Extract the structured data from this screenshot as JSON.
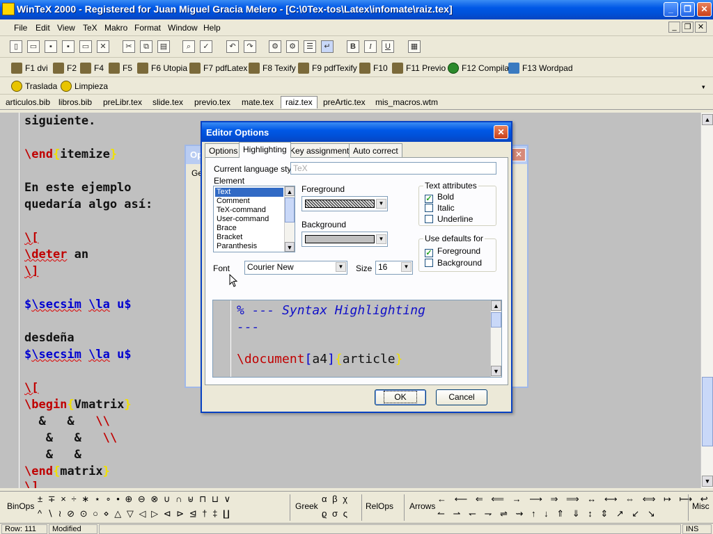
{
  "window": {
    "title": "WinTeX 2000 - Registered for Juan Miguel Gracia Melero - [C:\\0Tex-tos\\Latex\\infomate\\raiz.tex]"
  },
  "menu": [
    "File",
    "Edit",
    "View",
    "TeX",
    "Makro",
    "Format",
    "Window",
    "Help"
  ],
  "toolbar_main": {
    "bold": "B",
    "italic": "I",
    "underline": "U"
  },
  "toolbar_compile": [
    {
      "label": "F1 dvi"
    },
    {
      "label": "F2"
    },
    {
      "label": "F4"
    },
    {
      "label": "F5"
    },
    {
      "label": "F6 Utopia"
    },
    {
      "label": "F7 pdfLatex"
    },
    {
      "label": "F8 Texify"
    },
    {
      "label": "F9 pdfTexify"
    },
    {
      "label": "F10"
    },
    {
      "label": "F11 Previo"
    },
    {
      "label": "F12 Compila"
    },
    {
      "label": "F13 Wordpad"
    }
  ],
  "toolbar_macros": [
    {
      "label": "Traslada"
    },
    {
      "label": "Limpieza"
    }
  ],
  "file_tabs": [
    "articulos.bib",
    "libros.bib",
    "preLibr.tex",
    "slide.tex",
    "previo.tex",
    "mate.tex",
    "raiz.tex",
    "preArtic.tex",
    "mis_macros.wtm"
  ],
  "active_tab": "raiz.tex",
  "editor": {
    "l1": "siguiente.",
    "l2_cmd": "\\end",
    "l2_lb": "{",
    "l2_arg": "itemize",
    "l2_rb": "}",
    "l3a": "En este ejemplo",
    "l3b": "quedaría algo así:",
    "l4": "\\[",
    "l5_cmd": "\\deter",
    "l5_rest": " an",
    "l6": "\\]",
    "l7_dollar": "$",
    "l7_cmd": "\\secsim",
    "l7_sp": " ",
    "l7_cmd2": "\\la",
    "l7_rest": " u",
    "l7_end": "$",
    "l8": "desdeña",
    "l9_dollar": "$",
    "l9_cmd": "\\secsim",
    "l9_sp": " ",
    "l9_cmd2": "\\la",
    "l9_rest": " u",
    "l9_end": "$",
    "l10": "\\[",
    "l11_cmd": "\\begin",
    "l11_lb": "{",
    "l11_arg": "Vmatrix",
    "l11_rb": "}",
    "l12_amp": "  &   &   ",
    "l12_bs": "\\\\",
    "l13_amp": "   &   &   ",
    "l13_bs": "\\\\",
    "l14_amp": "   &   &",
    "l15_cmd": "\\end",
    "l15_lb": "{",
    "l15_arg": "matrix",
    "l15_rb": "}",
    "l16": "\\]"
  },
  "background_dialog": {
    "title_fragment": "Op",
    "tab_fragment": "Ge"
  },
  "dialog": {
    "title": "Editor Options",
    "tabs": [
      "Options",
      "Highlighting",
      "Key assignments",
      "Auto correct"
    ],
    "active_tab": "Highlighting",
    "language_label": "Current language style",
    "language_value": "TeX",
    "element_label": "Element",
    "elements": [
      "Text",
      "Comment",
      "TeX-command",
      "User-command",
      "Brace",
      "Bracket",
      "Paranthesis"
    ],
    "selected_element": "Text",
    "foreground_label": "Foreground",
    "background_label": "Background",
    "text_attributes": {
      "title": "Text attributes",
      "bold": {
        "label": "Bold",
        "checked": true
      },
      "italic": {
        "label": "Italic",
        "checked": false
      },
      "underline": {
        "label": "Underline",
        "checked": false
      }
    },
    "use_defaults": {
      "title": "Use defaults for",
      "foreground": {
        "label": "Foreground",
        "checked": true
      },
      "background": {
        "label": "Background",
        "checked": false
      }
    },
    "font_label": "Font",
    "font_value": "Courier New",
    "size_label": "Size",
    "size_value": "16",
    "preview": {
      "line1": "% --- Syntax Highlighting",
      "line2": "---",
      "l3_cmd": "\\document",
      "l3_lbr": "[",
      "l3_opt": "a4",
      "l3_rbr": "]",
      "l3_lb": "{",
      "l3_arg": "article",
      "l3_rb": "}"
    },
    "ok": "OK",
    "cancel": "Cancel"
  },
  "palette": {
    "binops": "BinOps",
    "binops_row1": "± ∓ × ÷ ∗ ⋆ ∘ • ⊕ ⊖ ⊗ ∪ ∩ ⊎ ⊓ ⊔ ∨",
    "binops_row2": "^ ∖ ≀ ⊘ ⊙ ○ ⋄ △ ▽ ◁ ▷ ⊲ ⊳ ⊴ † ‡ ∐",
    "greek": "Greek",
    "greek_row1": "α β χ",
    "greek_row2": "ϱ σ ς",
    "relops": "RelOps",
    "arrows": "Arrows",
    "arrows_row1": "← ⟵ ⇐ ⟸ → ⟶ ⇒ ⟹ ↔ ⟷ ⇔ ⟺ ↦ ⟼ ↩",
    "arrows_row2": "↼ ⇀ ↽ ⇁ ⇌ ⇝ ↑ ↓ ⇑ ⇓ ↕ ⇕ ↗ ↙ ↘",
    "misc": "Misc"
  },
  "status": {
    "row": "Row: 111",
    "modified": "Modified",
    "mode": "INS"
  }
}
